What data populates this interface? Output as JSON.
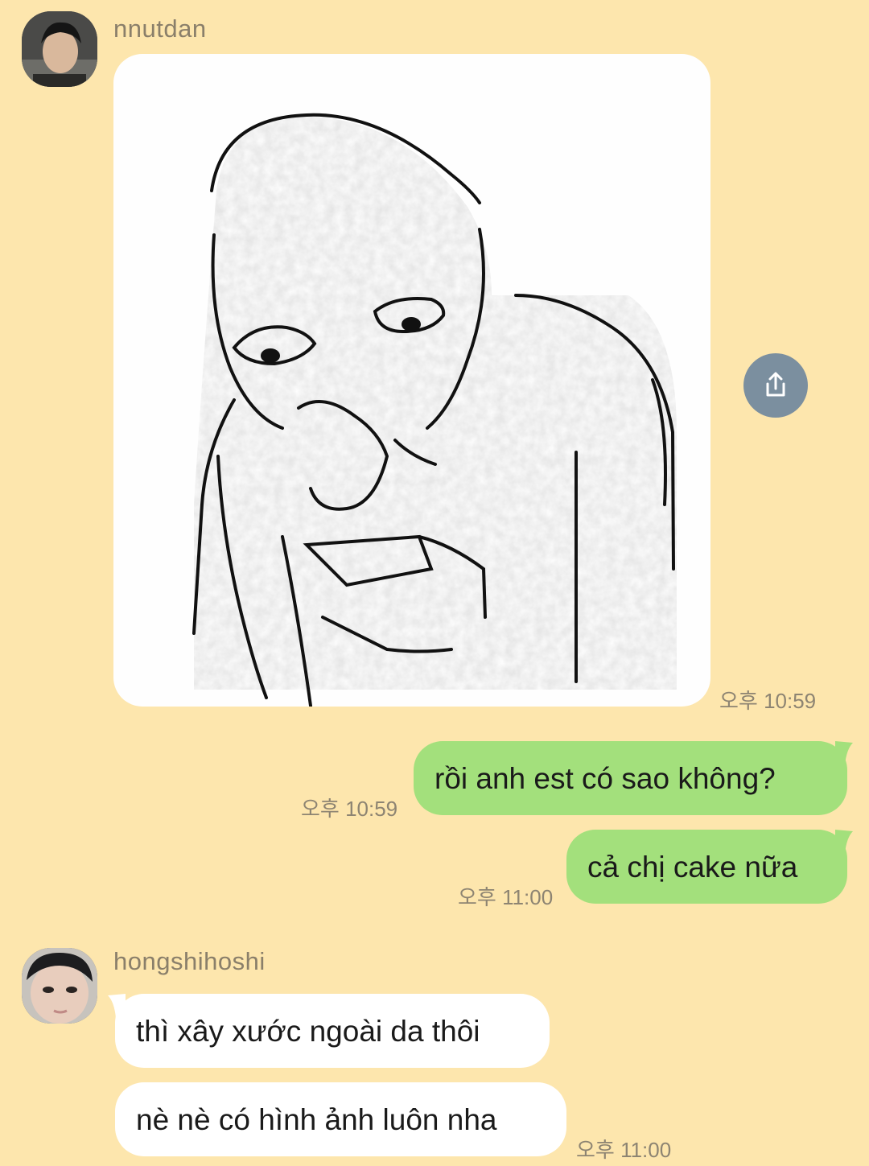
{
  "messages": [
    {
      "sender": "nnutdan",
      "type": "image",
      "time": "오후 10:59"
    },
    {
      "direction": "outgoing",
      "text": "rồi anh est có sao không?",
      "time": "오후 10:59"
    },
    {
      "direction": "outgoing",
      "text": "cả chị cake nữa",
      "time": "오후 11:00"
    },
    {
      "sender": "hongshihoshi",
      "direction": "incoming",
      "text": "thì xây xước ngoài da thôi"
    },
    {
      "direction": "incoming",
      "text": "nè nè có hình ảnh luôn nha",
      "time": "오후 11:00"
    }
  ],
  "icons": {
    "share": "share-icon"
  },
  "colors": {
    "background": "#fde6ad",
    "outgoing_bubble": "#a3e07c",
    "incoming_bubble": "#ffffff",
    "share_button": "#7b8f9f"
  }
}
